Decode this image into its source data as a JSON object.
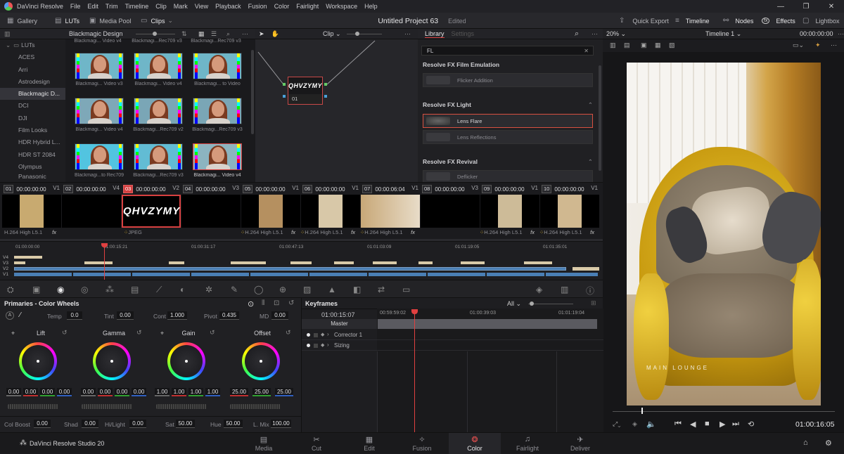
{
  "menu": {
    "app": "DaVinci Resolve",
    "items": [
      "File",
      "Edit",
      "Trim",
      "Timeline",
      "Clip",
      "Mark",
      "View",
      "Playback",
      "Fusion",
      "Color",
      "Fairlight",
      "Workspace",
      "Help"
    ]
  },
  "toolbar": {
    "gallery": "Gallery",
    "luts": "LUTs",
    "media_pool": "Media Pool",
    "clips": "Clips",
    "project_title": "Untitled Project 63",
    "edited": "Edited",
    "quick_export": "Quick Export",
    "timeline": "Timeline",
    "nodes": "Nodes",
    "effects": "Effects",
    "lightbox": "Lightbox"
  },
  "lut_panel": {
    "header": "Blackmagic Design",
    "tree": [
      "LUTs",
      "ACES",
      "Arri",
      "Astrodesign",
      "Blackmagic D...",
      "DCI",
      "DJI",
      "Film Looks",
      "HDR Hybrid L...",
      "HDR ST 2084",
      "Olympus",
      "Panasonic"
    ],
    "thumbs": [
      "Blackmagi... Video v3",
      "Blackmagi... Video v4",
      "Blackmagi... to Video",
      "Blackmagi... Video v4",
      "Blackmagi...Rec709 v2",
      "Blackmagi...Rec709 v3",
      "Blackmagi...to Rec709",
      "Blackmagi...Rec709 v3",
      "Blackmagi... Video v4"
    ],
    "top_labels": [
      "Blackmagi... Video v4",
      "Blackmagi...Rec709 v3",
      "Blackmagi...Rec709 v3"
    ]
  },
  "node_editor": {
    "clip_label": "Clip",
    "node_text": "QHVZYMY",
    "node_number": "01"
  },
  "library": {
    "tab_library": "Library",
    "tab_settings": "Settings",
    "search_value": "FL",
    "sections": [
      {
        "title": "Resolve FX Film Emulation",
        "items": [
          "Flicker Addition"
        ]
      },
      {
        "title": "Resolve FX Light",
        "items": [
          "Lens Flare",
          "Lens Reflections"
        ]
      },
      {
        "title": "Resolve FX Revival",
        "items": [
          "Deflicker"
        ]
      }
    ]
  },
  "viewer": {
    "zoom": "20%",
    "timeline_name": "Timeline 1",
    "timecode_top": "00:00:00:00",
    "timecode": "01:00:16:05",
    "watermark_text": "MAIN LOUNGE",
    "playhead_fraction": 0.13
  },
  "clips": [
    {
      "num": "01",
      "tc": "00:00:00:00",
      "track": "V1",
      "codec": "H.264 High L5.1",
      "fx": true
    },
    {
      "num": "02",
      "tc": "00:00:00:00",
      "track": "V4",
      "codec": "",
      "fx": false
    },
    {
      "num": "03",
      "tc": "00:00:00:00",
      "track": "V2",
      "codec": "JPEG",
      "fx": false,
      "selected": true
    },
    {
      "num": "04",
      "tc": "00:00:00:00",
      "track": "V3",
      "codec": "",
      "fx": false
    },
    {
      "num": "05",
      "tc": "00:00:00:00",
      "track": "V1",
      "codec": "H.264 High L5.1",
      "fx": true
    },
    {
      "num": "06",
      "tc": "00:00:00:00",
      "track": "V1",
      "codec": "H.264 High L5.1",
      "fx": true
    },
    {
      "num": "07",
      "tc": "00:00:06:04",
      "track": "V1",
      "codec": "H.264 High L5.1",
      "fx": true
    },
    {
      "num": "08",
      "tc": "00:00:00:00",
      "track": "V3",
      "codec": "",
      "fx": false
    },
    {
      "num": "09",
      "tc": "00:00:00:00",
      "track": "V1",
      "codec": "H.264 High L5.1",
      "fx": true
    },
    {
      "num": "10",
      "tc": "00:00:00:00",
      "track": "V1",
      "codec": "H.264 High L5.1",
      "fx": true
    }
  ],
  "mini_timeline": {
    "ticks": [
      "01:00:00:00",
      "01:00:15:21",
      "01:00:31:17",
      "01:00:47:13",
      "01:01:03:09",
      "01:01:19:05",
      "01:01:35:01"
    ],
    "tracks": [
      "V4",
      "V3",
      "V2",
      "V1"
    ]
  },
  "primaries": {
    "title": "Primaries - Color Wheels",
    "temp_label": "Temp",
    "temp": "0.0",
    "tint_label": "Tint",
    "tint": "0.00",
    "cont_label": "Cont",
    "cont": "1.000",
    "pivot_label": "Pivot",
    "pivot": "0.435",
    "md_label": "MD",
    "md": "0.00",
    "wheels": [
      {
        "name": "Lift",
        "values": [
          "0.00",
          "0.00",
          "0.00",
          "0.00"
        ]
      },
      {
        "name": "Gamma",
        "values": [
          "0.00",
          "0.00",
          "0.00",
          "0.00"
        ]
      },
      {
        "name": "Gain",
        "values": [
          "1.00",
          "1.00",
          "1.00",
          "1.00"
        ]
      },
      {
        "name": "Offset",
        "values": [
          "25.00",
          "25.00",
          "25.00"
        ]
      }
    ],
    "colboost_label": "Col Boost",
    "colboost": "0.00",
    "shad_label": "Shad",
    "shad": "0.00",
    "hilight_label": "Hi/Light",
    "hilight": "0.00",
    "sat_label": "Sat",
    "sat": "50.00",
    "hue_label": "Hue",
    "hue": "50.00",
    "lmix_label": "L. Mix",
    "lmix": "100.00"
  },
  "keyframes": {
    "title": "Keyframes",
    "filter": "All",
    "timecode": "01:00:15:07",
    "ticks": [
      "00:59:59:02",
      "01:00:39:03",
      "01:01:19:04"
    ],
    "rows": [
      "Master",
      "Corrector 1",
      "Sizing"
    ]
  },
  "pages": {
    "brand": "DaVinci Resolve Studio 20",
    "items": [
      "Media",
      "Cut",
      "Edit",
      "Fusion",
      "Color",
      "Fairlight",
      "Deliver"
    ],
    "selected": "Color"
  },
  "colors": {
    "accent": "#d84040",
    "bg": "#1c1c1f",
    "track_blue": "#4a7fb5",
    "track_tan": "#d9caa8"
  }
}
